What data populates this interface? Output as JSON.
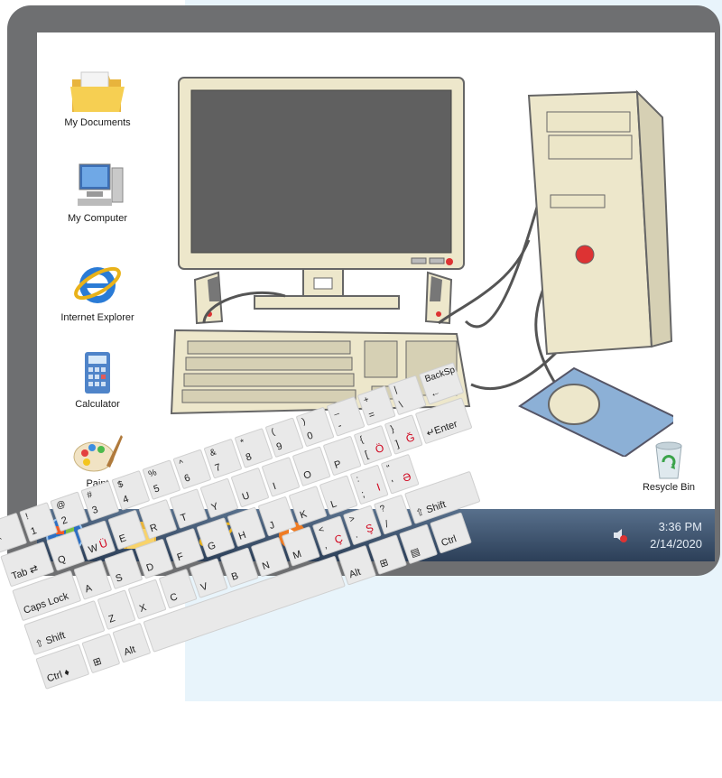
{
  "desktop": {
    "icons": [
      {
        "label": "My Documents",
        "icon": "folder-icon"
      },
      {
        "label": "My Computer",
        "icon": "computer-icon"
      },
      {
        "label": "Internet Explorer",
        "icon": "internet-explorer-icon"
      },
      {
        "label": "Calculator",
        "icon": "calculator-icon"
      },
      {
        "label": "Paint",
        "icon": "paint-icon"
      }
    ],
    "recycle_bin": {
      "label": "Resycle Bin",
      "icon": "recycle-bin-icon"
    }
  },
  "taskbar": {
    "items": [
      "start-button",
      "file-explorer-icon",
      "internet-explorer-icon",
      "media-player-icon"
    ],
    "clock_time": "3:36 PM",
    "clock_date": "2/14/2020"
  },
  "keyboard": {
    "row1": [
      {
        "top": "~",
        "main": "`"
      },
      {
        "top": "!",
        "main": "1"
      },
      {
        "top": "@",
        "main": "2"
      },
      {
        "top": "#",
        "main": "3"
      },
      {
        "top": "$",
        "main": "4"
      },
      {
        "top": "%",
        "main": "5"
      },
      {
        "top": "^",
        "main": "6"
      },
      {
        "top": "&",
        "main": "7"
      },
      {
        "top": "*",
        "main": "8"
      },
      {
        "top": "(",
        "main": "9"
      },
      {
        "top": ")",
        "main": "0"
      },
      {
        "top": "_",
        "main": "-"
      },
      {
        "top": "+",
        "main": "="
      },
      {
        "top": "|",
        "main": "\\"
      },
      {
        "top": "BackSp",
        "main": "←"
      }
    ],
    "row2": [
      {
        "top": "",
        "main": "Tab ⇄"
      },
      {
        "top": "",
        "main": "Q"
      },
      {
        "top": "",
        "main": "W",
        "extra": "Ü"
      },
      {
        "top": "",
        "main": "E"
      },
      {
        "top": "",
        "main": "R"
      },
      {
        "top": "",
        "main": "T"
      },
      {
        "top": "",
        "main": "Y"
      },
      {
        "top": "",
        "main": "U"
      },
      {
        "top": "",
        "main": "I"
      },
      {
        "top": "",
        "main": "O"
      },
      {
        "top": "",
        "main": "P"
      },
      {
        "top": "{",
        "main": "[",
        "extra": "Ö"
      },
      {
        "top": "}",
        "main": "]",
        "extra": "Ğ"
      },
      {
        "top": "",
        "main": "↵Enter"
      }
    ],
    "row3": [
      {
        "top": "",
        "main": "Caps Lock"
      },
      {
        "top": "",
        "main": "A"
      },
      {
        "top": "",
        "main": "S"
      },
      {
        "top": "",
        "main": "D"
      },
      {
        "top": "",
        "main": "F"
      },
      {
        "top": "",
        "main": "G"
      },
      {
        "top": "",
        "main": "H"
      },
      {
        "top": "",
        "main": "J"
      },
      {
        "top": "",
        "main": "K"
      },
      {
        "top": "",
        "main": "L"
      },
      {
        "top": ":",
        "main": ";",
        "extra": "I"
      },
      {
        "top": "\"",
        "main": "'",
        "extra": "Ə"
      }
    ],
    "row4": [
      {
        "top": "",
        "main": "⇧ Shift"
      },
      {
        "top": "",
        "main": "Z"
      },
      {
        "top": "",
        "main": "X"
      },
      {
        "top": "",
        "main": "C"
      },
      {
        "top": "",
        "main": "V"
      },
      {
        "top": "",
        "main": "B"
      },
      {
        "top": "",
        "main": "N"
      },
      {
        "top": "",
        "main": "M"
      },
      {
        "top": "<",
        "main": ",",
        "extra": "Ç"
      },
      {
        "top": ">",
        "main": ".",
        "extra": "Ş"
      },
      {
        "top": "?",
        "main": "/"
      },
      {
        "top": "",
        "main": "⇧ Shift"
      }
    ],
    "row5": [
      {
        "top": "",
        "main": "Ctrl ♦"
      },
      {
        "top": "",
        "main": "⊞"
      },
      {
        "top": "",
        "main": "Alt"
      },
      {
        "top": "",
        "main": ""
      },
      {
        "top": "",
        "main": "Alt"
      },
      {
        "top": "",
        "main": "⊞"
      },
      {
        "top": "",
        "main": "▤"
      },
      {
        "top": "",
        "main": "Ctrl"
      }
    ]
  },
  "colors": {
    "frame": "#6e6f71",
    "background_panel": "#e8f4fb",
    "taskbar": "#3d536e",
    "accent_red": "#d0021b"
  }
}
